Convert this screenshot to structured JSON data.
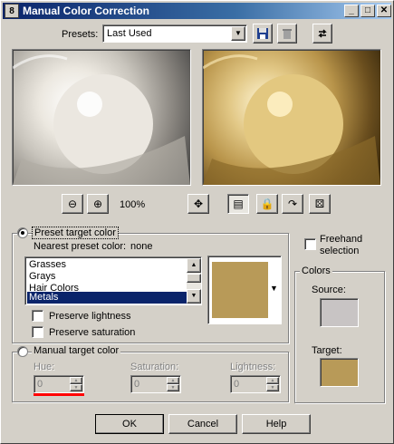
{
  "window": {
    "title": "Manual Color Correction",
    "app_icon": "8",
    "controls": {
      "minimize": "_",
      "maximize": "□",
      "close": "✕"
    }
  },
  "presets": {
    "label": "Presets:",
    "value": "Last Used",
    "save_icon": "save-icon",
    "delete_icon": "trash-icon",
    "reset_icon": "reset-icon"
  },
  "zoom": {
    "level": "100%"
  },
  "toolbar_icons": [
    "zoom-out-icon",
    "zoom-in-icon",
    "pan-icon",
    "proof-icon",
    "lock-icon",
    "link-icon",
    "randomize-icon"
  ],
  "preset_target": {
    "radio_label": "Preset target color",
    "nearest_label": "Nearest preset color:",
    "nearest_value": "none",
    "items": [
      "Grasses",
      "Grays",
      "Hair Colors",
      "Metals"
    ],
    "selected": "Metals",
    "preserve_lightness": "Preserve lightness",
    "preserve_saturation": "Preserve saturation"
  },
  "manual_target": {
    "radio_label": "Manual target color",
    "hue_label": "Hue:",
    "saturation_label": "Saturation:",
    "lightness_label": "Lightness:",
    "hue_value": "0",
    "saturation_value": "0",
    "lightness_value": "0"
  },
  "freehand": {
    "label_line1": "Freehand",
    "label_line2": "selection"
  },
  "colors": {
    "group_label": "Colors",
    "source_label": "Source:",
    "target_label": "Target:",
    "source_color": "#c8c4c4",
    "target_color": "#b89a58"
  },
  "buttons": {
    "ok": "OK",
    "cancel": "Cancel",
    "help": "Help"
  }
}
